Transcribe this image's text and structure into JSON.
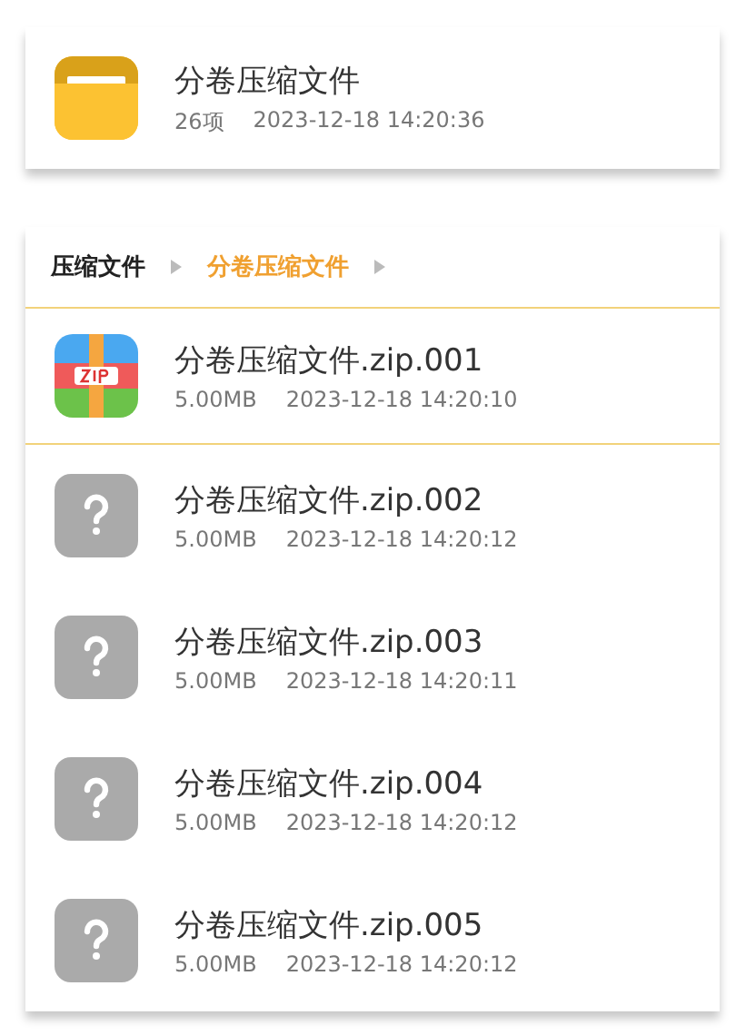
{
  "folder": {
    "name": "分卷压缩文件",
    "count": "26项",
    "modified": "2023-12-18 14:20:36"
  },
  "breadcrumb": [
    {
      "label": "压缩文件",
      "selected": false
    },
    {
      "label": "分卷压缩文件",
      "selected": true
    }
  ],
  "files": [
    {
      "kind": "zip",
      "name": "分卷压缩文件.zip.001",
      "size": "5.00MB",
      "modified": "2023-12-18 14:20:10",
      "selected": true
    },
    {
      "kind": "unknown",
      "name": "分卷压缩文件.zip.002",
      "size": "5.00MB",
      "modified": "2023-12-18 14:20:12",
      "selected": false
    },
    {
      "kind": "unknown",
      "name": "分卷压缩文件.zip.003",
      "size": "5.00MB",
      "modified": "2023-12-18 14:20:11",
      "selected": false
    },
    {
      "kind": "unknown",
      "name": "分卷压缩文件.zip.004",
      "size": "5.00MB",
      "modified": "2023-12-18 14:20:12",
      "selected": false
    },
    {
      "kind": "unknown",
      "name": "分卷压缩文件.zip.005",
      "size": "5.00MB",
      "modified": "2023-12-18 14:20:12",
      "selected": false
    }
  ]
}
